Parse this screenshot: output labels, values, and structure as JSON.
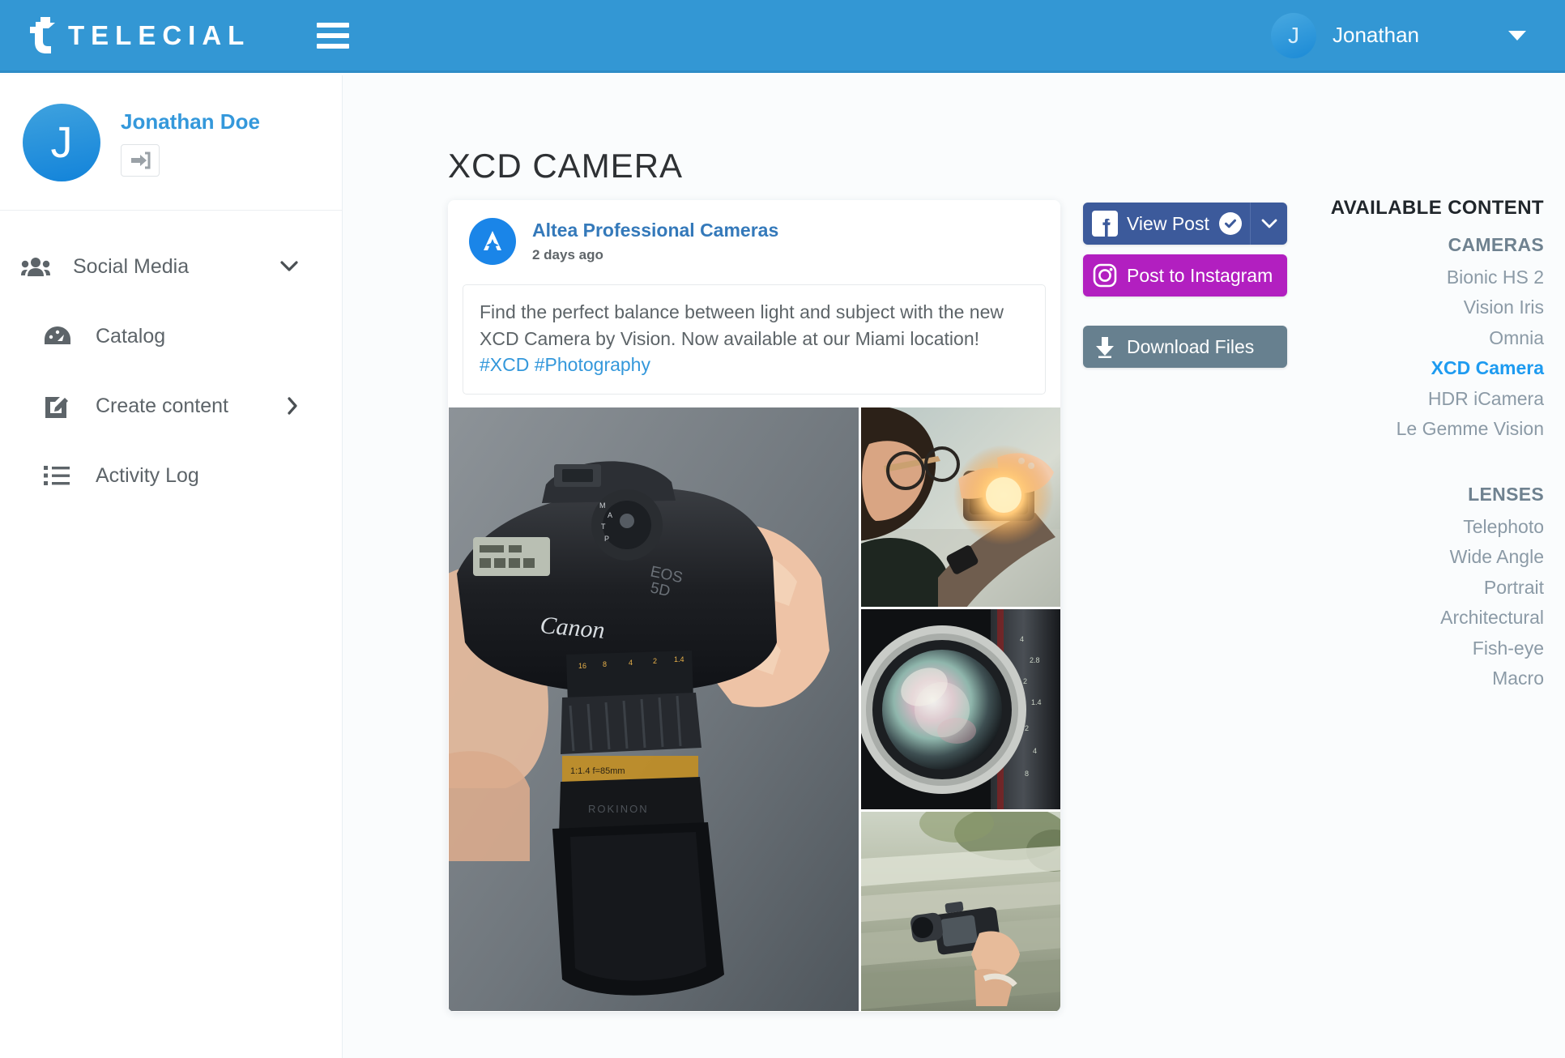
{
  "header": {
    "logo_text": "TELECIAL",
    "logo_icon": "telecial-bird-logo-icon",
    "menu_icon": "hamburger-menu-icon",
    "user_initial": "J",
    "user_name": "Jonathan",
    "caret_icon": "chevron-down-icon",
    "bg_color": "#3397d4"
  },
  "sidebar": {
    "profile": {
      "initial": "J",
      "name": "Jonathan Doe",
      "logout_icon": "sign-out-icon"
    },
    "items": [
      {
        "label": "Social Media",
        "icon": "users-group-icon",
        "arrow": "chevron-down-icon",
        "level": "top"
      },
      {
        "label": "Catalog",
        "icon": "dashboard-gauge-icon",
        "arrow": "",
        "level": "sub"
      },
      {
        "label": "Create content",
        "icon": "edit-pencil-square-icon",
        "arrow": "chevron-right-icon",
        "level": "sub"
      },
      {
        "label": "Activity Log",
        "icon": "list-ul-icon",
        "arrow": "",
        "level": "sub"
      }
    ]
  },
  "main": {
    "page_title": "XCD CAMERA",
    "post": {
      "brand_avatar_icon": "altea-a-logo-icon",
      "brand_name": "Altea Professional Cameras",
      "timestamp": "2 days ago",
      "text_before": "Find the perfect balance between light and subject with the new XCD Camera by Vision. Now available at our Miami location! ",
      "hashtags": [
        "#XCD",
        "#Photography"
      ],
      "images": [
        {
          "name": "hands-holding-canon-eos-5d-camera",
          "alt": "Hands holding a black Canon EOS 5D camera with large lens"
        },
        {
          "name": "photographer-shooting-into-sunlight",
          "alt": "Man with glasses holding small camera with sun flare"
        },
        {
          "name": "closeup-85mm-lens-front-element",
          "alt": "Close-up of an 85mm lens front element"
        },
        {
          "name": "hand-holding-mirrorless-camera-motion-blur",
          "alt": "Hand holding a mirrorless camera, motion blurred background"
        }
      ]
    },
    "actions": [
      {
        "label": "View Post",
        "icon": "facebook-icon",
        "badge_icon": "check-circle-icon",
        "split_icon": "chevron-down-icon",
        "color": "#3c5a9b"
      },
      {
        "label": "Post to Instagram",
        "icon": "instagram-icon",
        "color": "#b21fc0"
      },
      {
        "label": "Download Files",
        "icon": "download-arrow-icon",
        "color": "#67808f"
      }
    ]
  },
  "right_panel": {
    "title": "AVAILABLE CONTENT",
    "groups": [
      {
        "title": "CAMERAS",
        "items": [
          {
            "label": "Bionic HS 2",
            "active": false
          },
          {
            "label": "Vision Iris",
            "active": false
          },
          {
            "label": "Omnia",
            "active": false
          },
          {
            "label": "XCD Camera",
            "active": true
          },
          {
            "label": "HDR iCamera",
            "active": false
          },
          {
            "label": "Le Gemme Vision",
            "active": false
          }
        ]
      },
      {
        "title": "LENSES",
        "items": [
          {
            "label": "Telephoto",
            "active": false
          },
          {
            "label": "Wide Angle",
            "active": false
          },
          {
            "label": "Portrait",
            "active": false
          },
          {
            "label": "Architectural",
            "active": false
          },
          {
            "label": "Fish-eye",
            "active": false
          },
          {
            "label": "Macro",
            "active": false
          }
        ]
      }
    ]
  },
  "colors": {
    "brand_blue": "#3397d4",
    "accent_link": "#3498db",
    "facebook": "#3c5a9b",
    "instagram": "#b21fc0",
    "download": "#67808f",
    "active_item": "#1e9bf0",
    "page_bg": "#fafcfd"
  }
}
